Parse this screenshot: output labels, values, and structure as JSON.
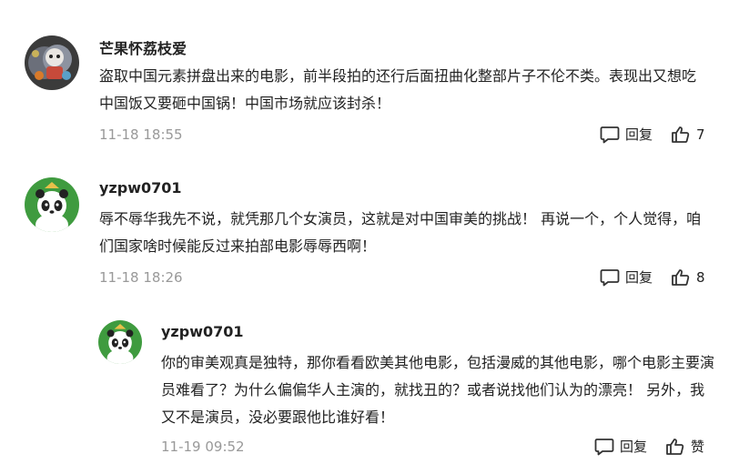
{
  "comments": [
    {
      "username": "芒果怀荔枝爱",
      "avatar": "photo-avatar",
      "text": "盗取中国元素拼盘出来的电影，前半段拍的还行后面扭曲化整部片子不伦不类。表现出又想吃中国饭又要砸中国锅！中国市场就应该封杀！",
      "time": "11-18 18:55",
      "reply_label": "回复",
      "like_count": "7"
    },
    {
      "username": "yzpw0701",
      "avatar": "panda-avatar",
      "text": "辱不辱华我先不说，就凭那几个女演员，这就是对中国审美的挑战！ 再说一个，个人觉得，咱们国家啥时候能反过来拍部电影辱辱西啊！",
      "time": "11-18 18:26",
      "reply_label": "回复",
      "like_count": "8"
    }
  ],
  "reply": {
    "username": "yzpw0701",
    "avatar": "panda-avatar",
    "text": "你的审美观真是独特，那你看看欧美其他电影，包括漫威的其他电影，哪个电影主要演员难看了？为什么偏偏华人主演的，就找丑的？或者说找他们认为的漂亮！ 另外，我又不是演员，没必要跟他比谁好看！",
    "time": "11-19 09:52",
    "reply_label": "回复",
    "like_label": "赞"
  },
  "colors": {
    "text": "#222222",
    "meta": "#999999",
    "panda_bg": "#3f9b3f"
  },
  "icons": [
    "comment-icon",
    "thumbs-up-icon"
  ]
}
